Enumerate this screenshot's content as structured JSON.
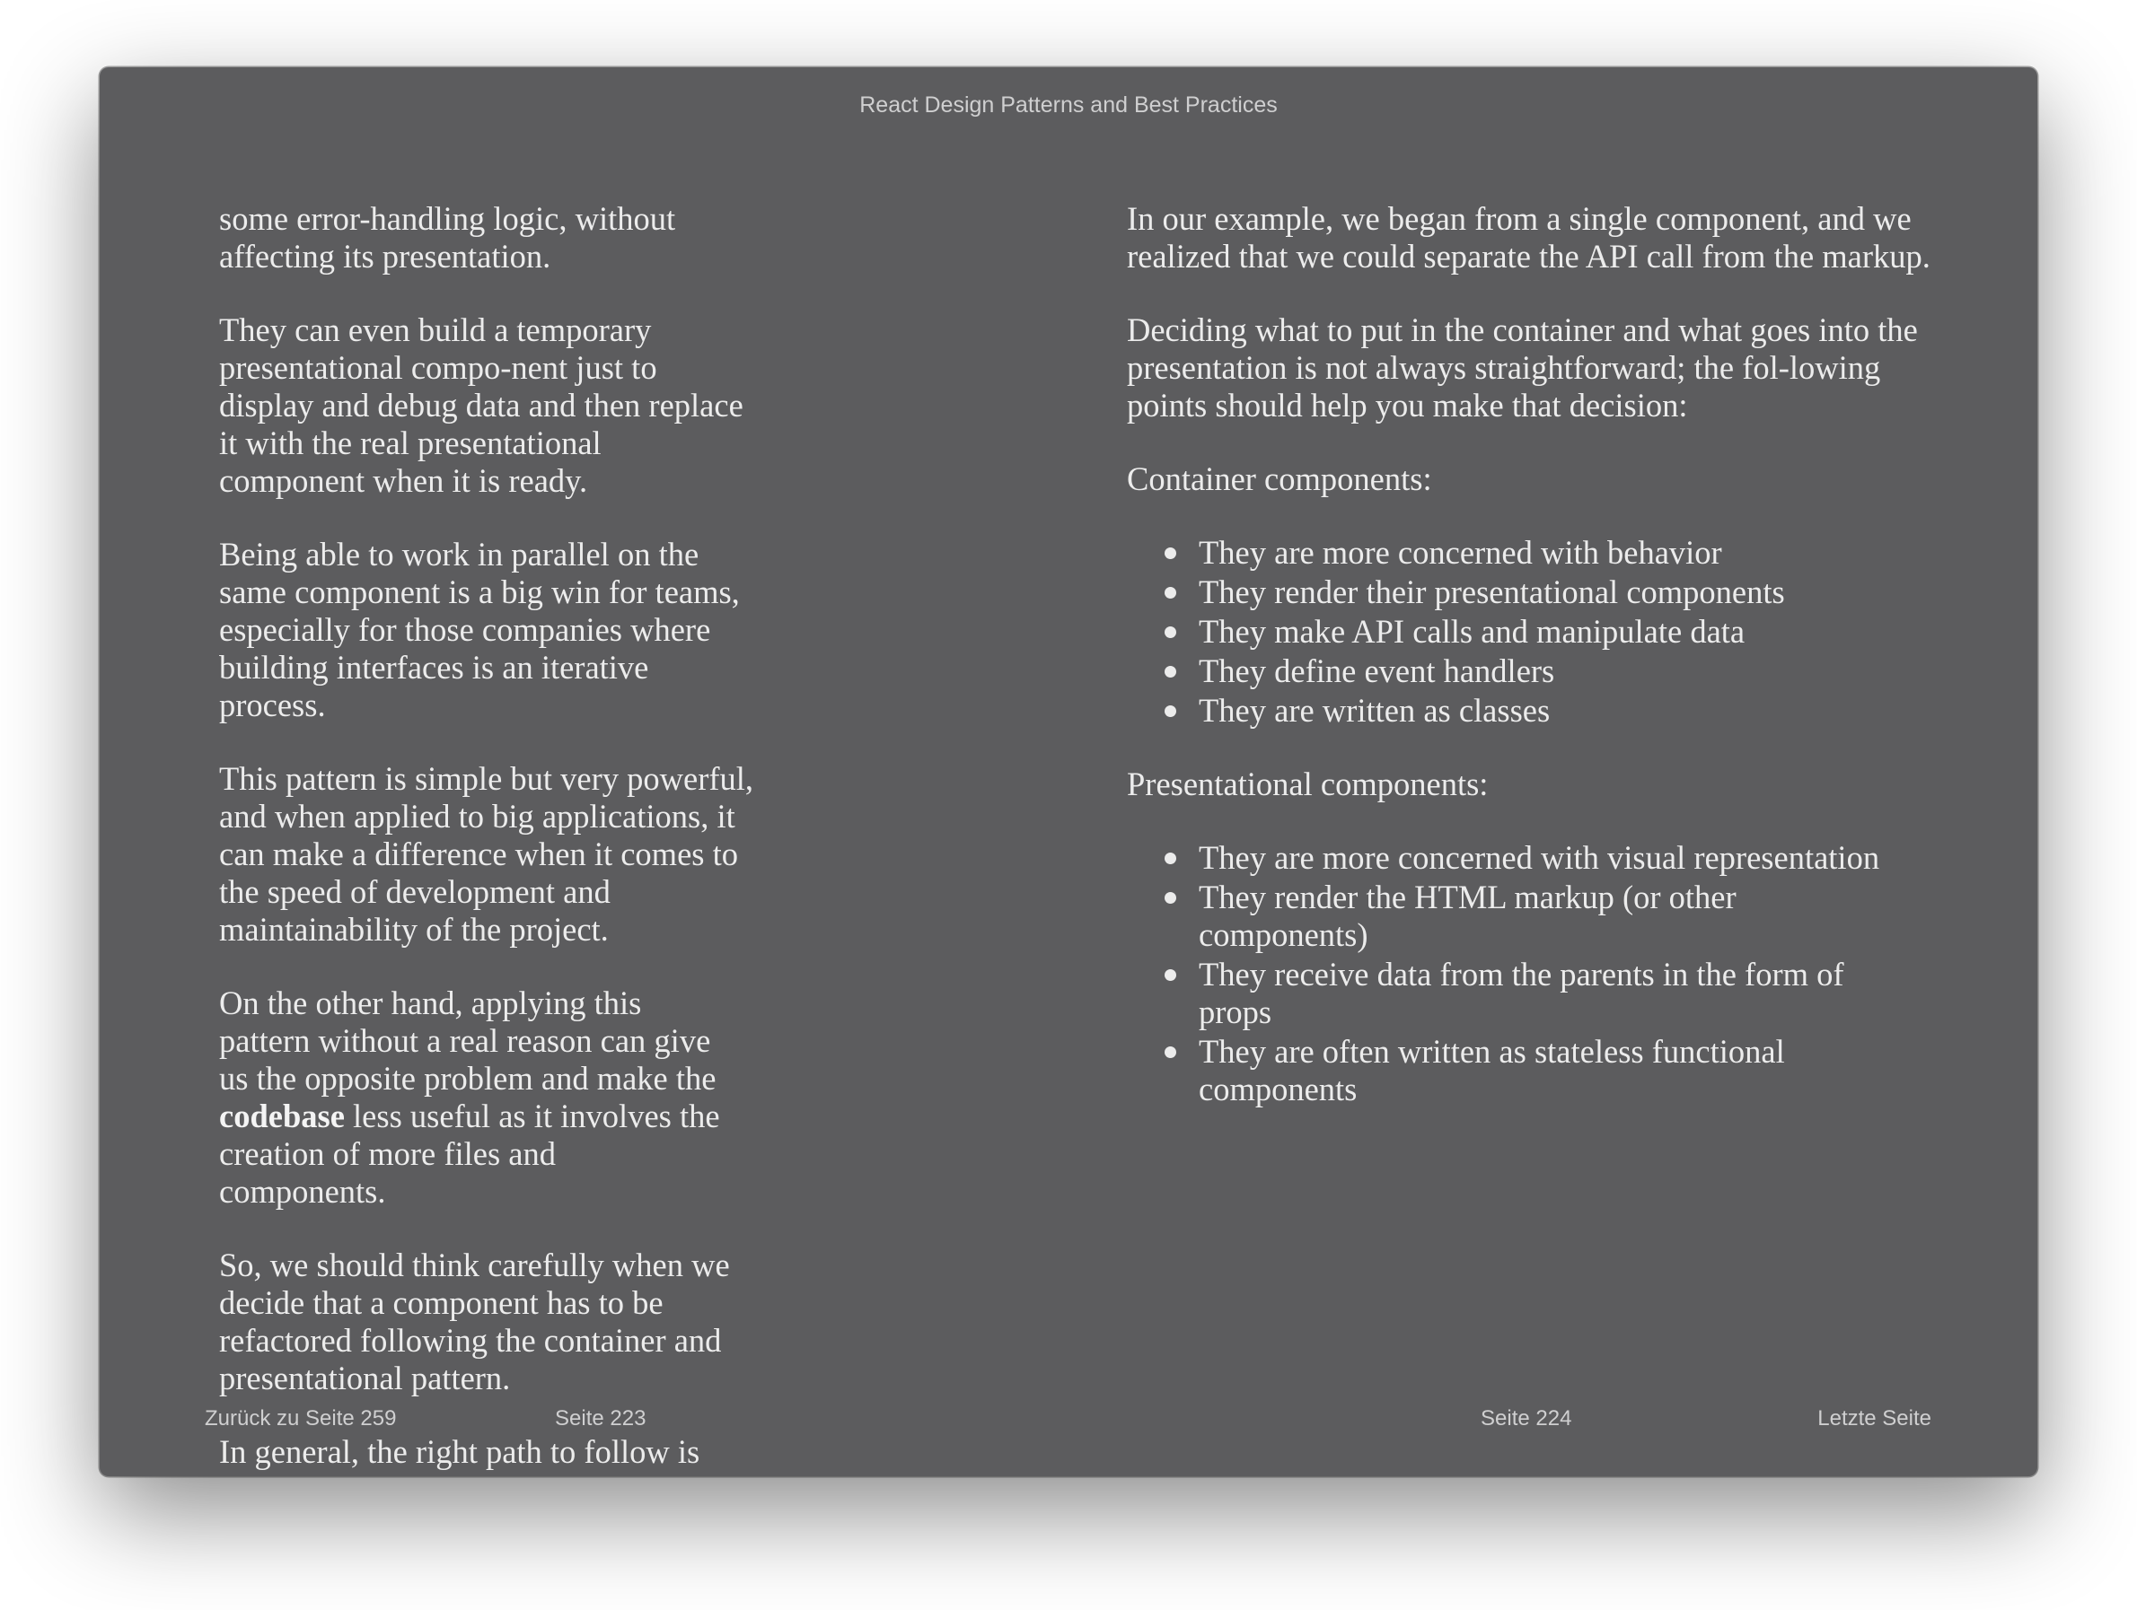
{
  "window": {
    "title": "React Design Patterns and Best Practices"
  },
  "left_page": {
    "paragraphs": [
      "some error-handling logic, without affecting its presentation.",
      "They can even build a temporary presentational compo-nent just to display and debug data and then replace it with the real presentational component when it is ready.",
      "Being able to work in parallel on the same component is a big win for teams, especially for those companies where building interfaces is an iterative process.",
      "This pattern is simple but very powerful, and when applied to big applications, it can make a difference when it comes to the speed of development and maintainability of the project.",
      {
        "before": "On the other hand, applying this pattern without a real reason can give us the opposite problem and make the ",
        "bold": "codebase",
        "after": " less useful as it involves the creation of more files and components."
      },
      "So, we should think carefully when we decide that a component has to be refactored following the container and presentational pattern.",
      "In general, the right path to follow is starting with a sin-gle component and splitting it only when the logic and the presentation become too coupled where they shouldn't be."
    ]
  },
  "right_page": {
    "intro_1": "In our example, we began from a single component, and we realized that we could separate the API call from the markup.",
    "intro_2": "Deciding what to put in the container and what goes into the presentation is not always straightforward; the fol-lowing points should help you make that decision:",
    "container_label": "Container components:",
    "container_items": [
      "They are more concerned with behavior",
      "They render their presentational components",
      "They make API calls and manipulate data",
      "They define event handlers",
      "They are written as classes"
    ],
    "presentational_label": "Presentational components:",
    "presentational_items": [
      "They are more concerned with visual representation",
      "They render the HTML markup (or other components)",
      "They receive data from the parents in the form of props",
      "They are often written as stateless functional components"
    ]
  },
  "footer": {
    "back_link": "Zurück zu Seite 259",
    "left_page_number": "Seite 223",
    "right_page_number": "Seite 224",
    "last_page_link": "Letzte Seite"
  }
}
